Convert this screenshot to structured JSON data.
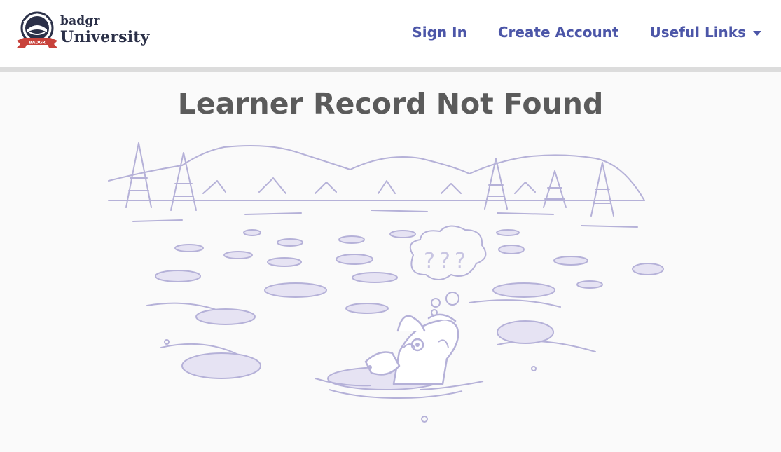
{
  "brand": {
    "small": "badgr",
    "large": "University",
    "banner_text": "BADGR"
  },
  "nav": {
    "sign_in": "Sign In",
    "create_account": "Create Account",
    "useful_links": "Useful Links"
  },
  "page": {
    "title": "Learner Record Not Found",
    "thought_text": "???"
  },
  "colors": {
    "accent": "#4c56a8",
    "title": "#5b5b5b",
    "illustration": "#b5b1d8",
    "illustration_fill": "#e6e3f3"
  }
}
